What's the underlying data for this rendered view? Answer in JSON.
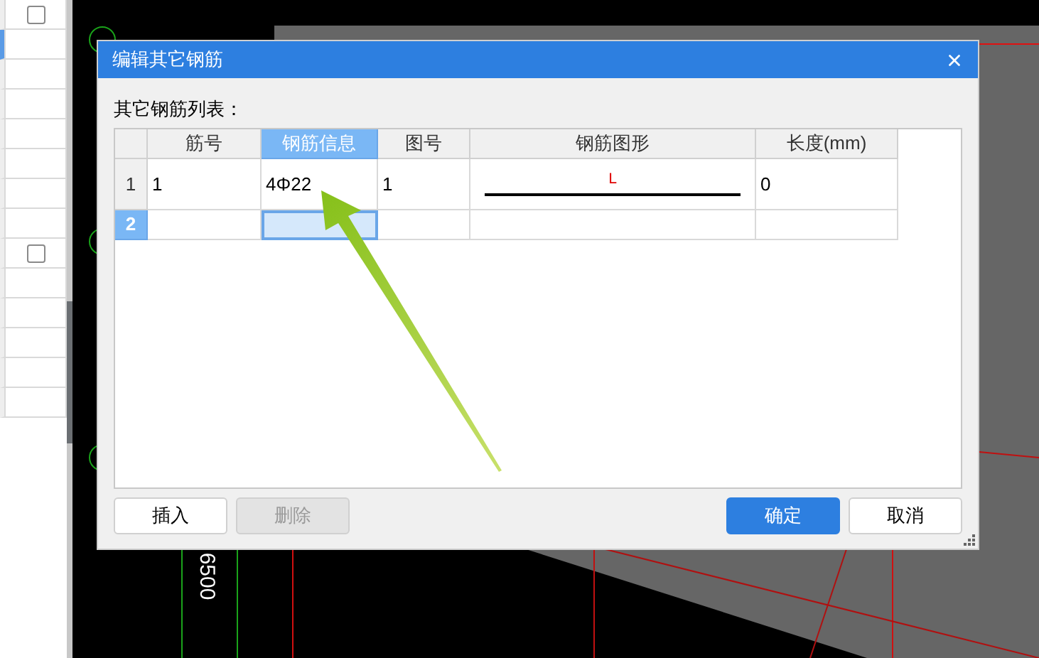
{
  "left_panel": {
    "rows": [
      {
        "kind": "checkbox",
        "checked": false,
        "selected": false
      },
      {
        "kind": "blank",
        "selected": true
      },
      {
        "kind": "blank",
        "selected": false
      },
      {
        "kind": "blank",
        "selected": false
      },
      {
        "kind": "blank",
        "selected": false
      },
      {
        "kind": "blank",
        "selected": false
      },
      {
        "kind": "blank",
        "selected": false
      },
      {
        "kind": "blank",
        "selected": false
      },
      {
        "kind": "checkbox",
        "checked": false,
        "selected": false
      },
      {
        "kind": "blank",
        "selected": false
      },
      {
        "kind": "blank",
        "selected": false
      },
      {
        "kind": "blank",
        "selected": false
      },
      {
        "kind": "blank",
        "selected": false
      },
      {
        "kind": "blank",
        "selected": false
      }
    ]
  },
  "canvas": {
    "dimension_label": "6500"
  },
  "dialog": {
    "title": "编辑其它钢筋",
    "list_label": "其它钢筋列表：",
    "table": {
      "columns": [
        {
          "label": "筋号",
          "selected": false
        },
        {
          "label": "钢筋信息",
          "selected": true
        },
        {
          "label": "图号",
          "selected": false
        },
        {
          "label": "钢筋图形",
          "selected": false
        },
        {
          "label": "长度(mm)",
          "selected": false
        }
      ],
      "rows": [
        {
          "header": "1",
          "selected": false,
          "cells": [
            {
              "kind": "text",
              "text": "1",
              "selected": false
            },
            {
              "kind": "text",
              "text": "4Φ22",
              "selected": false
            },
            {
              "kind": "text",
              "text": "1",
              "selected": false
            },
            {
              "kind": "shape",
              "text": "L",
              "selected": false
            },
            {
              "kind": "text",
              "text": "0",
              "selected": false
            }
          ]
        },
        {
          "header": "2",
          "selected": true,
          "cells": [
            {
              "kind": "text",
              "selected": false
            },
            {
              "kind": "text",
              "selected": true
            },
            {
              "kind": "text",
              "selected": false
            },
            {
              "kind": "text",
              "selected": false
            },
            {
              "kind": "text",
              "selected": false
            }
          ]
        }
      ]
    },
    "left_buttons": [
      {
        "label": "插入",
        "kind": "default",
        "disabled": false
      },
      {
        "label": "删除",
        "kind": "default",
        "disabled": true
      }
    ],
    "right_buttons": [
      {
        "label": "确定",
        "kind": "primary",
        "disabled": false
      },
      {
        "label": "取消",
        "kind": "default",
        "disabled": false
      }
    ]
  }
}
